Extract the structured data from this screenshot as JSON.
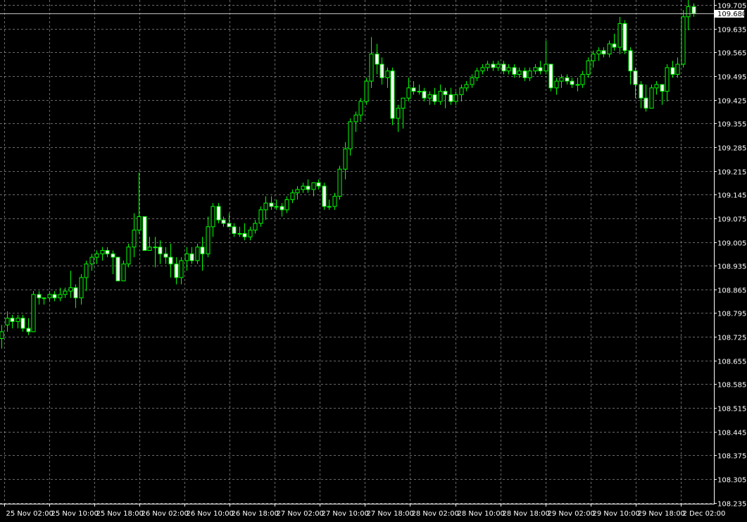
{
  "chart_data": {
    "type": "candlestick",
    "title": "",
    "xlabel": "",
    "ylabel": "",
    "ylim": [
      108.215,
      109.72
    ],
    "grid": true,
    "y_ticks": [
      "109.705",
      "109.635",
      "109.565",
      "109.495",
      "109.425",
      "109.355",
      "109.285",
      "109.215",
      "109.145",
      "109.075",
      "109.005",
      "108.935",
      "108.865",
      "108.795",
      "108.725",
      "108.655",
      "108.585",
      "108.515",
      "108.445",
      "108.375",
      "108.305",
      "108.235"
    ],
    "x_ticks": [
      "25 Nov 02:00",
      "25 Nov 10:00",
      "25 Nov 18:00",
      "26 Nov 02:00",
      "26 Nov 10:00",
      "26 Nov 18:00",
      "27 Nov 02:00",
      "27 Nov 10:00",
      "27 Nov 18:00",
      "28 Nov 02:00",
      "28 Nov 10:00",
      "28 Nov 18:00",
      "29 Nov 02:00",
      "29 Nov 10:00",
      "29 Nov 18:00",
      "2 Dec 02:00"
    ],
    "current_price": "109.680",
    "colors": {
      "background": "#000000",
      "grid": "#c0c0c0",
      "axis": "#ffffff",
      "bull_body": "#000000",
      "bear_body": "#ffffff",
      "wick": "#00ff00",
      "price_line": "#c0c0c0"
    },
    "series": [
      {
        "candles": [
          [
            108.72,
            108.76,
            108.69,
            108.74
          ],
          [
            108.76,
            108.8,
            108.74,
            108.78
          ],
          [
            108.78,
            108.79,
            108.75,
            108.77
          ],
          [
            108.77,
            108.79,
            108.75,
            108.78
          ],
          [
            108.78,
            108.79,
            108.74,
            108.75
          ],
          [
            108.75,
            108.78,
            108.73,
            108.74
          ],
          [
            108.74,
            108.86,
            108.74,
            108.85
          ],
          [
            108.85,
            108.86,
            108.82,
            108.84
          ],
          [
            108.84,
            108.84,
            108.82,
            108.84
          ],
          [
            108.84,
            108.86,
            108.83,
            108.85
          ],
          [
            108.85,
            108.86,
            108.83,
            108.84
          ],
          [
            108.84,
            108.87,
            108.83,
            108.85
          ],
          [
            108.85,
            108.87,
            108.84,
            108.86
          ],
          [
            108.86,
            108.92,
            108.84,
            108.87
          ],
          [
            108.87,
            108.88,
            108.81,
            108.84
          ],
          [
            108.84,
            108.91,
            108.82,
            108.9
          ],
          [
            108.9,
            108.95,
            108.86,
            108.94
          ],
          [
            108.94,
            108.97,
            108.92,
            108.96
          ],
          [
            108.96,
            108.98,
            108.94,
            108.97
          ],
          [
            108.97,
            108.99,
            108.95,
            108.98
          ],
          [
            108.98,
            108.99,
            108.96,
            108.97
          ],
          [
            108.97,
            108.98,
            108.91,
            108.96
          ],
          [
            108.96,
            108.96,
            108.89,
            108.89
          ],
          [
            108.89,
            108.95,
            108.89,
            108.94
          ],
          [
            108.94,
            109.0,
            108.93,
            108.99
          ],
          [
            108.99,
            109.09,
            108.96,
            109.04
          ],
          [
            109.04,
            109.21,
            109.03,
            109.08
          ],
          [
            109.08,
            109.08,
            108.98,
            108.98
          ],
          [
            108.98,
            109.02,
            108.98,
            108.99
          ],
          [
            108.99,
            109.02,
            108.93,
            108.99
          ],
          [
            108.99,
            109.01,
            108.94,
            108.97
          ],
          [
            108.97,
            108.99,
            108.94,
            108.96
          ],
          [
            108.96,
            109.0,
            108.9,
            108.94
          ],
          [
            108.94,
            108.96,
            108.88,
            108.9
          ],
          [
            108.9,
            108.96,
            108.88,
            108.95
          ],
          [
            108.95,
            108.99,
            108.92,
            108.97
          ],
          [
            108.97,
            108.99,
            108.94,
            108.95
          ],
          [
            108.95,
            109.0,
            108.94,
            108.99
          ],
          [
            108.99,
            109.02,
            108.92,
            108.97
          ],
          [
            108.97,
            109.08,
            108.96,
            109.05
          ],
          [
            109.05,
            109.12,
            109.02,
            109.11
          ],
          [
            109.11,
            109.12,
            109.06,
            109.07
          ],
          [
            109.07,
            109.08,
            109.05,
            109.06
          ],
          [
            109.06,
            109.09,
            109.05,
            109.05
          ],
          [
            109.05,
            109.06,
            109.02,
            109.03
          ],
          [
            109.03,
            109.05,
            109.02,
            109.03
          ],
          [
            109.03,
            109.06,
            109.01,
            109.02
          ],
          [
            109.02,
            109.05,
            109.01,
            109.04
          ],
          [
            109.04,
            109.07,
            109.03,
            109.06
          ],
          [
            109.06,
            109.11,
            109.05,
            109.1
          ],
          [
            109.1,
            109.14,
            109.07,
            109.12
          ],
          [
            109.12,
            109.14,
            109.1,
            109.11
          ],
          [
            109.11,
            109.13,
            109.1,
            109.11
          ],
          [
            109.11,
            109.12,
            109.08,
            109.1
          ],
          [
            109.1,
            109.14,
            109.09,
            109.13
          ],
          [
            109.13,
            109.16,
            109.12,
            109.15
          ],
          [
            109.15,
            109.17,
            109.13,
            109.16
          ],
          [
            109.16,
            109.18,
            109.15,
            109.17
          ],
          [
            109.17,
            109.19,
            109.15,
            109.16
          ],
          [
            109.16,
            109.18,
            109.14,
            109.18
          ],
          [
            109.18,
            109.19,
            109.16,
            109.17
          ],
          [
            109.17,
            109.18,
            109.1,
            109.11
          ],
          [
            109.11,
            109.13,
            109.1,
            109.11
          ],
          [
            109.11,
            109.15,
            109.1,
            109.14
          ],
          [
            109.14,
            109.23,
            109.13,
            109.22
          ],
          [
            109.22,
            109.3,
            109.19,
            109.28
          ],
          [
            109.28,
            109.37,
            109.26,
            109.36
          ],
          [
            109.36,
            109.39,
            109.33,
            109.38
          ],
          [
            109.38,
            109.43,
            109.36,
            109.42
          ],
          [
            109.42,
            109.49,
            109.41,
            109.48
          ],
          [
            109.48,
            109.61,
            109.46,
            109.56
          ],
          [
            109.56,
            109.59,
            109.5,
            109.53
          ],
          [
            109.53,
            109.55,
            109.47,
            109.49
          ],
          [
            109.49,
            109.52,
            109.46,
            109.51
          ],
          [
            109.51,
            109.52,
            109.35,
            109.37
          ],
          [
            109.37,
            109.41,
            109.33,
            109.4
          ],
          [
            109.4,
            109.43,
            109.34,
            109.43
          ],
          [
            109.43,
            109.49,
            109.42,
            109.46
          ],
          [
            109.46,
            109.48,
            109.44,
            109.45
          ],
          [
            109.45,
            109.47,
            109.44,
            109.45
          ],
          [
            109.45,
            109.46,
            109.42,
            109.43
          ],
          [
            109.43,
            109.45,
            109.41,
            109.44
          ],
          [
            109.44,
            109.46,
            109.41,
            109.42
          ],
          [
            109.42,
            109.47,
            109.41,
            109.45
          ],
          [
            109.45,
            109.46,
            109.4,
            109.44
          ],
          [
            109.44,
            109.46,
            109.41,
            109.42
          ],
          [
            109.42,
            109.45,
            109.41,
            109.44
          ],
          [
            109.44,
            109.47,
            109.42,
            109.46
          ],
          [
            109.46,
            109.48,
            109.45,
            109.47
          ],
          [
            109.47,
            109.5,
            109.46,
            109.49
          ],
          [
            109.49,
            109.52,
            109.48,
            109.51
          ],
          [
            109.51,
            109.53,
            109.5,
            109.52
          ],
          [
            109.52,
            109.54,
            109.51,
            109.53
          ],
          [
            109.53,
            109.54,
            109.51,
            109.52
          ],
          [
            109.52,
            109.54,
            109.51,
            109.53
          ],
          [
            109.53,
            109.54,
            109.5,
            109.51
          ],
          [
            109.51,
            109.53,
            109.5,
            109.52
          ],
          [
            109.52,
            109.53,
            109.49,
            109.5
          ],
          [
            109.5,
            109.52,
            109.49,
            109.51
          ],
          [
            109.51,
            109.52,
            109.48,
            109.49
          ],
          [
            109.49,
            109.52,
            109.48,
            109.51
          ],
          [
            109.51,
            109.53,
            109.5,
            109.52
          ],
          [
            109.52,
            109.54,
            109.5,
            109.51
          ],
          [
            109.51,
            109.6,
            109.5,
            109.53
          ],
          [
            109.53,
            109.53,
            109.45,
            109.46
          ],
          [
            109.46,
            109.49,
            109.44,
            109.48
          ],
          [
            109.48,
            109.5,
            109.46,
            109.49
          ],
          [
            109.49,
            109.5,
            109.47,
            109.48
          ],
          [
            109.48,
            109.49,
            109.46,
            109.47
          ],
          [
            109.47,
            109.49,
            109.45,
            109.47
          ],
          [
            109.47,
            109.51,
            109.46,
            109.5
          ],
          [
            109.5,
            109.55,
            109.49,
            109.54
          ],
          [
            109.54,
            109.57,
            109.52,
            109.56
          ],
          [
            109.56,
            109.58,
            109.54,
            109.57
          ],
          [
            109.57,
            109.58,
            109.55,
            109.56
          ],
          [
            109.56,
            109.6,
            109.55,
            109.59
          ],
          [
            109.59,
            109.62,
            109.57,
            109.58
          ],
          [
            109.58,
            109.67,
            109.56,
            109.65
          ],
          [
            109.65,
            109.66,
            109.56,
            109.57
          ],
          [
            109.57,
            109.58,
            109.47,
            109.51
          ],
          [
            109.51,
            109.52,
            109.43,
            109.47
          ],
          [
            109.47,
            109.48,
            109.4,
            109.43
          ],
          [
            109.43,
            109.47,
            109.39,
            109.4
          ],
          [
            109.4,
            109.47,
            109.4,
            109.46
          ],
          [
            109.46,
            109.48,
            109.44,
            109.47
          ],
          [
            109.47,
            109.47,
            109.41,
            109.45
          ],
          [
            109.45,
            109.53,
            109.42,
            109.52
          ],
          [
            109.52,
            109.54,
            109.49,
            109.5
          ],
          [
            109.5,
            109.55,
            109.49,
            109.53
          ],
          [
            109.53,
            109.69,
            109.52,
            109.67
          ],
          [
            109.67,
            109.72,
            109.63,
            109.7
          ],
          [
            109.7,
            109.71,
            109.67,
            109.68
          ]
        ]
      }
    ]
  }
}
